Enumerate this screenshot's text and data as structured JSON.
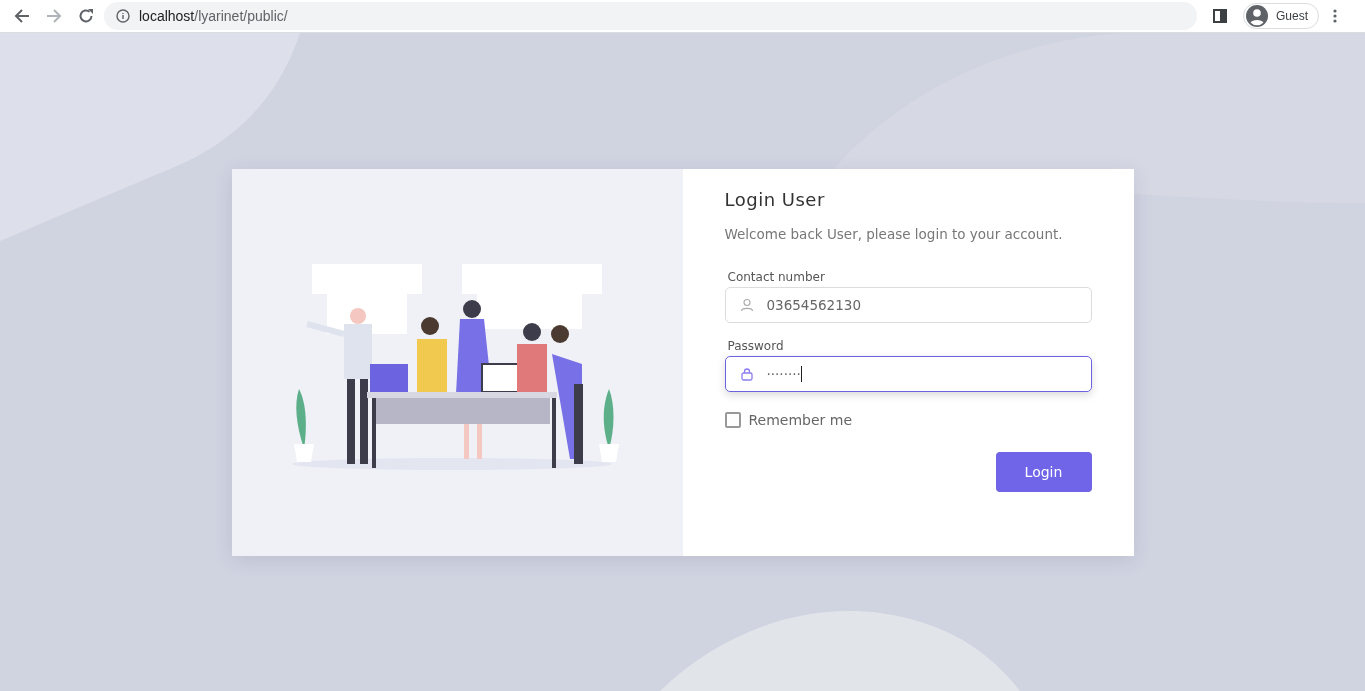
{
  "browser": {
    "url_host": "localhost",
    "url_path": "/lyarinet/public/",
    "profile": "Guest"
  },
  "login": {
    "title": "Login User",
    "subtitle": "Welcome back User, please login to your account.",
    "fields": [
      {
        "kind": "user",
        "label": "Contact number",
        "value": "03654562130",
        "focused": false
      },
      {
        "kind": "lock",
        "label": "Password",
        "value": "········",
        "focused": true
      }
    ],
    "remember": {
      "label": "Remember me",
      "checked": false
    },
    "button": "Login"
  }
}
